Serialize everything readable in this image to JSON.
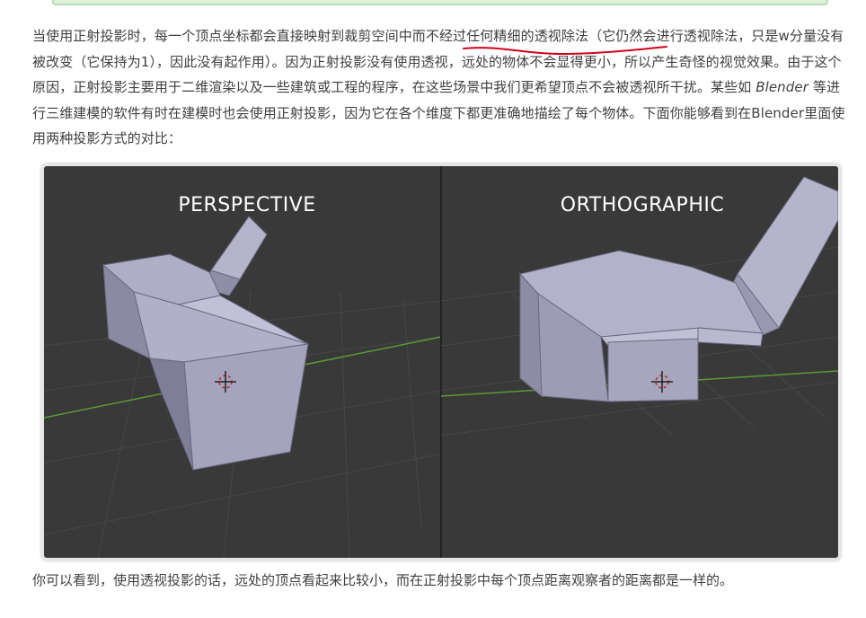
{
  "paragraph": {
    "part1": "当使用正射投影时，每一个顶点坐标都会直接映射到裁剪空间中而不经过任何精细的透视除法（它仍然会进行透视除法，只是w分量没有被改变（它保持为1），因此没有起作用）。因为正射投影没有使用透视，远处的物体不会显得更小，所以产生奇怪的视觉效果。由于这个原因，正射投影主要用于二维渲染以及一些建筑或工程的程序，在这些场景中我们更希望顶点不会被透视所干扰。某些如 ",
    "emphasis": "Blender",
    "part2": " 等进行三维建模的软件有时在建模时也会使用正射投影，因为它在各个维度下都更准确地描绘了每个物体。下面你能够看到在Blender里面使用两种投影方式的对比："
  },
  "figure": {
    "left_title": "PERSPECTIVE",
    "right_title": "ORTHOGRAPHIC"
  },
  "caption": "你可以看到，使用透视投影的话，远处的顶点看起来比较小，而在正射投影中每个顶点距离观察者的距离都是一样的。",
  "colors": {
    "text": "#404040",
    "underline": "#d0021b",
    "viewport_bg": "#393939",
    "mesh_face": "#a9a9c2",
    "grid_x_axis": "#5a9a3a"
  }
}
